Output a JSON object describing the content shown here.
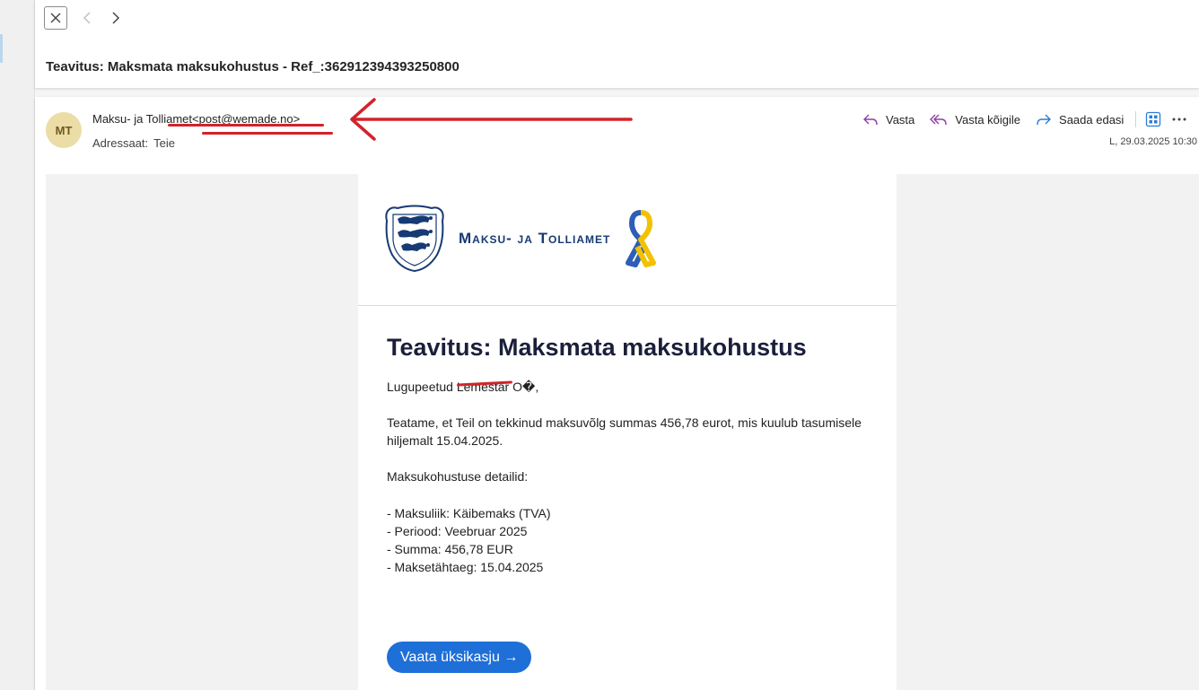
{
  "reading_pane": {
    "subject": "Teavitus: Maksmata maksukohustus - Ref_:362912394393250800"
  },
  "message": {
    "avatar_initials": "MT",
    "sender_name": "Maksu- ja Tolliamet",
    "sender_email": "<post@wemade.no>",
    "to_label": "Adressaat:",
    "to_value": "Teie",
    "date": "L, 29.03.2025 10:30",
    "actions": {
      "reply": "Vasta",
      "reply_all": "Vasta kõigile",
      "forward": "Saada edasi"
    }
  },
  "email_body": {
    "org_name": "Maksu- ja Tolliamet",
    "title": "Teavitus: Maksmata maksukohustus",
    "greeting": "Lugupeetud Lemestar O�,",
    "paragraph1": "Teatame, et Teil on tekkinud maksuvõlg summas 456,78 eurot, mis kuulub tasumisele hiljemalt 15.04.2025.",
    "details_heading": "Maksukohustuse detailid:",
    "details": [
      "- Maksuliik: Käibemaks (TVA)",
      "- Periood: Veebruar 2025",
      "- Summa: 456,78 EUR",
      "- Maksetähtaeg: 15.04.2025"
    ],
    "button_label": "Vaata üksikasju →"
  },
  "colors": {
    "annotation_red": "#d2232a",
    "button_blue": "#1f6fd8",
    "brand_navy": "#163a73",
    "ribbon_blue": "#2c5fb5",
    "ribbon_yellow": "#f2c200"
  },
  "icons": [
    "close-icon",
    "back-icon",
    "forward-nav-icon",
    "reply-icon",
    "reply-all-icon",
    "forward-icon",
    "apps-icon",
    "more-icon",
    "coat-of-arms-icon",
    "ukraine-ribbon-icon",
    "red-arrow-annotation"
  ]
}
